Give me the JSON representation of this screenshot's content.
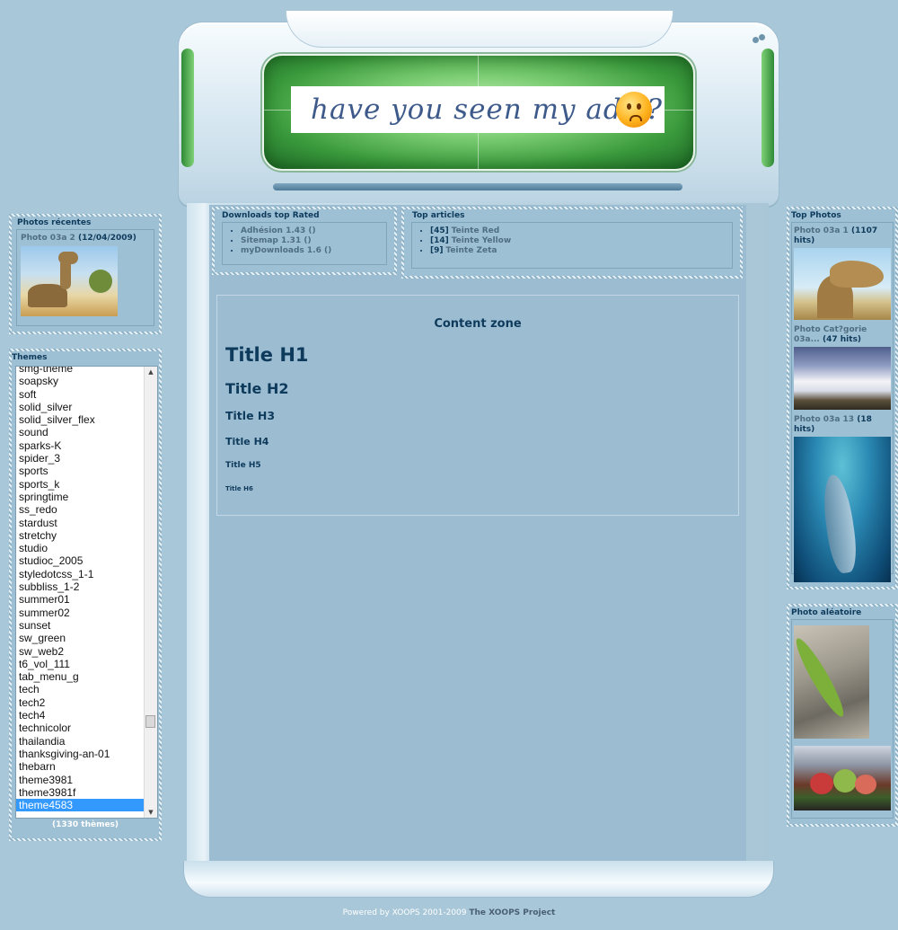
{
  "header": {
    "banner_text": "have you seen my ads ?",
    "banner_icon": "smiley-face-icon"
  },
  "left": {
    "recent": {
      "title": "Photos récentes",
      "photo_title": "Photo 03a 2",
      "photo_date": "(12/04/2009)"
    },
    "themes": {
      "title": "Themes",
      "items": [
        "smg-theme",
        "soapsky",
        "soft",
        "solid_silver",
        "solid_silver_flex",
        "sound",
        "sparks-K",
        "spider_3",
        "sports",
        "sports_k",
        "springtime",
        "ss_redo",
        "stardust",
        "stretchy",
        "studio",
        "studioc_2005",
        "styledotcss_1-1",
        "subbliss_1-2",
        "summer01",
        "summer02",
        "sunset",
        "sw_green",
        "sw_web2",
        "t6_vol_111",
        "tab_menu_g",
        "tech",
        "tech2",
        "tech4",
        "technicolor",
        "thailandia",
        "thanksgiving-an-01",
        "thebarn",
        "theme3981",
        "theme3981f",
        "theme4583"
      ],
      "selected": "theme4583",
      "count": "(1330 thèmes)"
    }
  },
  "center": {
    "downloads": {
      "title": "Downloads top Rated",
      "items": [
        "Adhésion 1.43 ()",
        "Sitemap 1.31 ()",
        "myDownloads 1.6 ()"
      ]
    },
    "top_articles": {
      "title": "Top articles",
      "items": [
        {
          "count": "[45]",
          "label": "Teinte Red"
        },
        {
          "count": "[14]",
          "label": "Teinte Yellow"
        },
        {
          "count": "[9]",
          "label": "Teinte Zeta"
        }
      ]
    },
    "content": {
      "title": "Content zone",
      "h1": "Title H1",
      "h2": "Title H2",
      "h3": "Title H3",
      "h4": "Title H4",
      "h5": "Title H5",
      "h6": "Title H6"
    }
  },
  "right": {
    "top_photos": {
      "title": "Top Photos",
      "entries": [
        {
          "name": "Photo 03a 1",
          "hits": "(1107 hits)"
        },
        {
          "name": "Photo Cat?gorie 03a...",
          "hits": "(47 hits)"
        },
        {
          "name": "Photo 03a 13",
          "hits": "(18 hits)"
        }
      ]
    },
    "random": {
      "title": "Photo aléatoire"
    }
  },
  "footer": {
    "powered_by": "Powered by XOOPS 2001-2009",
    "project": "The XOOPS Project"
  }
}
